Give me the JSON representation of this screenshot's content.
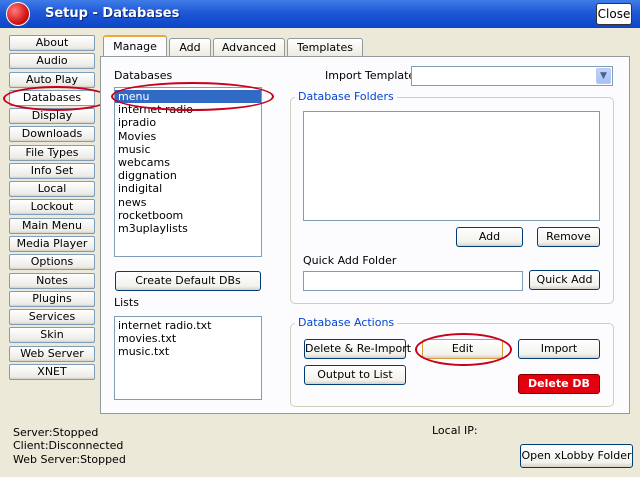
{
  "window": {
    "title": "Setup - Databases",
    "close_label": "Close"
  },
  "sidebar": {
    "items": [
      {
        "label": "About"
      },
      {
        "label": "Audio"
      },
      {
        "label": "Auto Play"
      },
      {
        "label": "Databases"
      },
      {
        "label": "Display"
      },
      {
        "label": "Downloads"
      },
      {
        "label": "File Types"
      },
      {
        "label": "Info Set"
      },
      {
        "label": "Local"
      },
      {
        "label": "Lockout"
      },
      {
        "label": "Main Menu"
      },
      {
        "label": "Media Player"
      },
      {
        "label": "Options"
      },
      {
        "label": "Notes"
      },
      {
        "label": "Plugins"
      },
      {
        "label": "Services"
      },
      {
        "label": "Skin"
      },
      {
        "label": "Web Server"
      },
      {
        "label": "XNET"
      }
    ],
    "active": "Databases"
  },
  "tabs": [
    {
      "label": "Manage"
    },
    {
      "label": "Add"
    },
    {
      "label": "Advanced"
    },
    {
      "label": "Templates"
    }
  ],
  "manage": {
    "databases_label": "Databases",
    "databases": [
      "menu",
      "internet radio",
      "ipradio",
      "Movies",
      "music",
      "webcams",
      "diggnation",
      "indigital",
      "news",
      "rocketboom",
      "m3uplaylists"
    ],
    "selected_database": "menu",
    "create_default_label": "Create Default DBs",
    "lists_label": "Lists",
    "lists": [
      "internet radio.txt",
      "movies.txt",
      "music.txt"
    ],
    "import_template_label": "Import Template",
    "import_template_value": "",
    "folders_group_label": "Database Folders",
    "add_label": "Add",
    "remove_label": "Remove",
    "quick_add_label": "Quick Add Folder",
    "quick_add_value": "",
    "quick_add_button": "Quick Add",
    "actions_group_label": "Database Actions",
    "delete_reimport_label": "Delete & Re-Import",
    "edit_label": "Edit",
    "import_label": "Import",
    "output_list_label": "Output to List",
    "delete_db_label": "Delete DB"
  },
  "status": {
    "server": "Server:Stopped",
    "client": "Client:Disconnected",
    "web_server": "Web Server:Stopped",
    "local_ip_label": "Local IP:",
    "open_folder_label": "Open xLobby Folder"
  },
  "colors": {
    "titlebar": "#0b46c7",
    "selection": "#316ac5",
    "delete": "#e3000f",
    "annotation": "#c8001a",
    "group_title": "#0046d5"
  }
}
